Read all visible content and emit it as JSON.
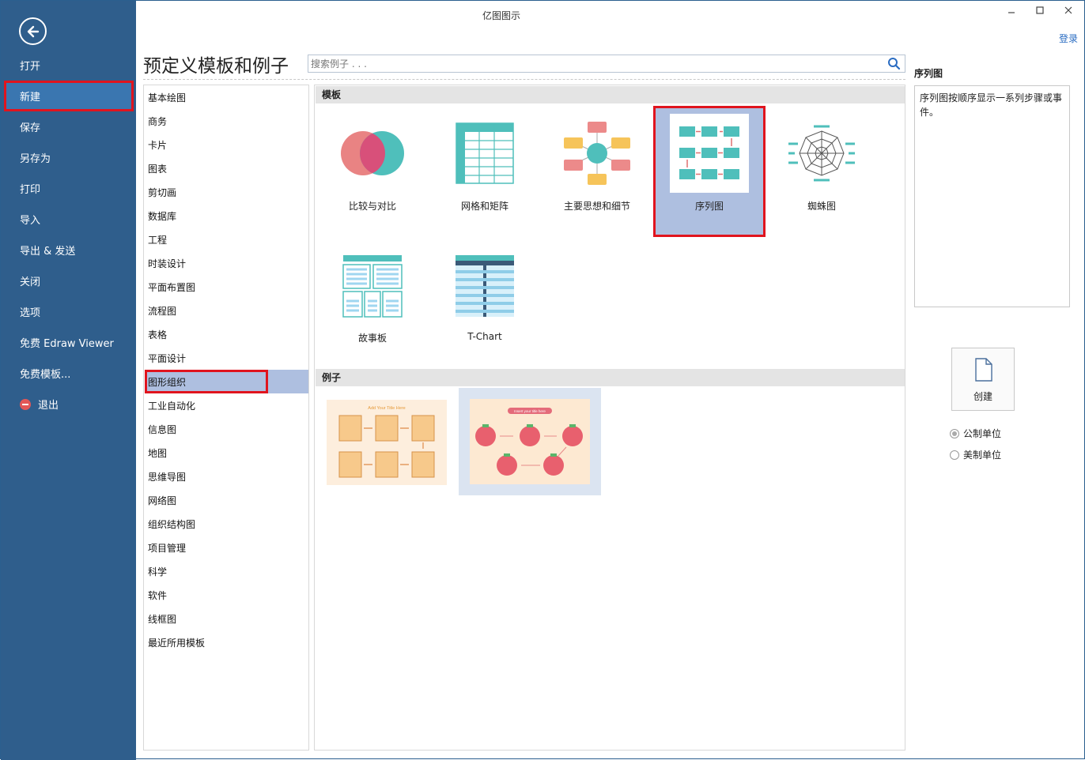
{
  "window": {
    "title": "亿图图示",
    "login": "登录"
  },
  "sidebar": {
    "items": [
      {
        "label": "打开"
      },
      {
        "label": "新建"
      },
      {
        "label": "保存"
      },
      {
        "label": "另存为"
      },
      {
        "label": "打印"
      },
      {
        "label": "导入"
      },
      {
        "label": "导出 & 发送"
      },
      {
        "label": "关闭"
      },
      {
        "label": "选项"
      },
      {
        "label": "免费 Edraw Viewer"
      },
      {
        "label": "免费模板..."
      },
      {
        "label": "退出"
      }
    ],
    "active": "新建"
  },
  "header": {
    "title": "预定义模板和例子",
    "search_placeholder": "搜索例子 . . ."
  },
  "categories": {
    "items": [
      "基本绘图",
      "商务",
      "卡片",
      "图表",
      "剪切画",
      "数据库",
      "工程",
      "时装设计",
      "平面布置图",
      "流程图",
      "表格",
      "平面设计",
      "图形组织",
      "工业自动化",
      "信息图",
      "地图",
      "思维导图",
      "网络图",
      "组织结构图",
      "项目管理",
      "科学",
      "软件",
      "线框图",
      "最近所用模板"
    ],
    "selected": "图形组织"
  },
  "templates": {
    "heading": "模板",
    "items": [
      {
        "label": "比较与对比",
        "icon": "venn-diagram-icon"
      },
      {
        "label": "网格和矩阵",
        "icon": "grid-matrix-icon"
      },
      {
        "label": "主要思想和细节",
        "icon": "main-idea-icon"
      },
      {
        "label": "序列图",
        "icon": "sequence-chart-icon"
      },
      {
        "label": "蜘蛛图",
        "icon": "spider-diagram-icon"
      },
      {
        "label": "故事板",
        "icon": "storyboard-icon"
      },
      {
        "label": "T-Chart",
        "icon": "t-chart-icon"
      }
    ],
    "selected": "序列图"
  },
  "examples": {
    "heading": "例子",
    "items": [
      {
        "title": "Add Your Title Here"
      },
      {
        "title": "Insert your title here"
      }
    ]
  },
  "details": {
    "heading": "序列图",
    "description": "序列图按顺序显示一系列步骤或事件。",
    "create_label": "创建",
    "units": [
      {
        "label": "公制单位",
        "checked": true
      },
      {
        "label": "美制单位",
        "checked": false
      }
    ]
  },
  "colors": {
    "sidebar": "#2f5e8c",
    "sidebar_active": "#3a76b0",
    "selection": "#aebfe0",
    "highlight_border": "#e0141e",
    "link": "#2a6cc2"
  }
}
